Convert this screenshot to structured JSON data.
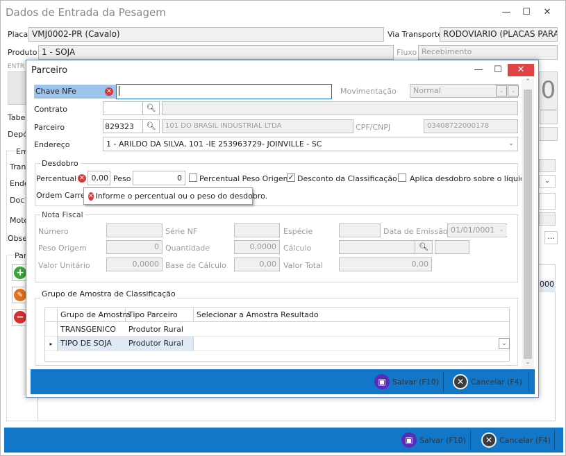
{
  "main": {
    "title": "Dados de Entrada da Pesagem",
    "placa_label": "Placa",
    "placa_value": "VMJ0002-PR (Cavalo)",
    "via_label": "Via Transporte",
    "via_value": "RODOVIARIO (PLACAS PARA",
    "produto_label": "Produto",
    "produto_value": "1 - SOJA",
    "fluxo_label": "Fluxo",
    "fluxo_value": "Recebimento",
    "entrada_label": "ENTR",
    "tabela_label": "Tabel",
    "deposito_label": "Depó",
    "em_label": "Em",
    "trans_label": "Trans",
    "ende_label": "Ende",
    "doc_label": "Doc F",
    "moto_label": "Moto",
    "obse_label": "Obse",
    "par_label": "Par",
    "big_digit": "0",
    "right_value": "000",
    "save_label": "Salvar (F10)",
    "cancel_label": "Cancelar (F4)"
  },
  "dialog": {
    "title": "Parceiro",
    "chave_label": "Chave NFe",
    "chave_value": "",
    "mov_label": "Movimentação",
    "mov_value": "Normal",
    "contrato_label": "Contrato",
    "parceiro_label": "Parceiro",
    "parceiro_code": "829323",
    "parceiro_name": "101 DO BRASIL INDUSTRIAL LTDA",
    "cpf_label": "CPF/CNPJ",
    "cpf_value": "03408722000178",
    "endereco_label": "Endereço",
    "endereco_value": "1 - ARILDO DA SILVA, 101 -IE 253963729- JOINVILLE - SC",
    "desdobro": {
      "title": "Desdobro",
      "percentual_label": "Percentual",
      "percentual_value": "0,00",
      "peso_label": "Peso",
      "peso_value": "0",
      "chk_percentual_label": "Percentual Peso Origem",
      "chk_desconto_label": "Desconto da Classificação",
      "chk_aplica_label": "Aplica desdobro sobre o líquido",
      "ordem_label": "Ordem Carreg",
      "tooltip": "Informe o percentual ou o peso do desdobro."
    },
    "nota": {
      "title": "Nota Fiscal",
      "numero_label": "Número",
      "serie_label": "Série NF",
      "especie_label": "Espécie",
      "data_label": "Data de Emissão",
      "data_value": "01/01/0001",
      "peso_origem_label": "Peso Origem",
      "peso_origem_value": "0",
      "quantidade_label": "Quantidade",
      "quantidade_value": "0,0000",
      "calculo_label": "Cálculo",
      "valor_unit_label": "Valor Unitário",
      "valor_unit_value": "0,0000",
      "base_label": "Base de Cálculo",
      "base_value": "0,00",
      "valor_total_label": "Valor Total",
      "valor_total_value": "0,00"
    },
    "grupo": {
      "title": "Grupo de Amostra de Classificação",
      "headers": [
        "Grupo de Amostra",
        "Tipo Parceiro",
        "Selecionar a Amostra Resultado"
      ],
      "rows": [
        [
          "TRANSGENICO",
          "Produtor Rural",
          ""
        ],
        [
          "TIPO DE SOJA",
          "Produtor Rural",
          ""
        ]
      ]
    },
    "save_label": "Salvar (F10)",
    "cancel_label": "Cancelar (F4)"
  },
  "colors": {
    "accent_bar": "#1277c9",
    "error": "#d63b3b",
    "close_button": "#e04343",
    "highlight_label": "#9cc3ec"
  }
}
